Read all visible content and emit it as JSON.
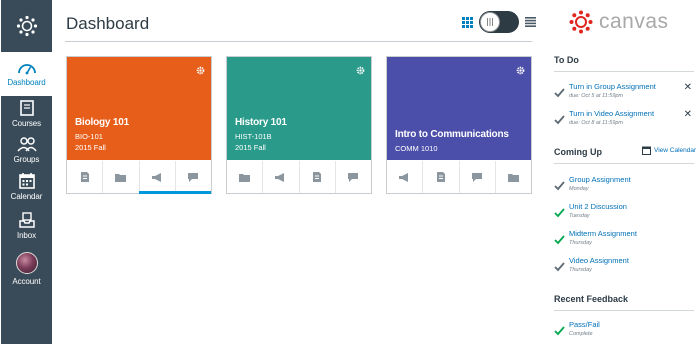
{
  "nav": {
    "items": [
      {
        "label": "Dashboard",
        "icon": "speedometer-icon"
      },
      {
        "label": "Courses",
        "icon": "book-icon"
      },
      {
        "label": "Groups",
        "icon": "people-icon"
      },
      {
        "label": "Calendar",
        "icon": "calendar-icon"
      },
      {
        "label": "Inbox",
        "icon": "inbox-icon"
      },
      {
        "label": "Account",
        "icon": "avatar"
      }
    ]
  },
  "header": {
    "title": "Dashboard"
  },
  "cards": [
    {
      "name": "Biology 101",
      "code": "BIO-101",
      "term": "2015 Fall",
      "color": "#e75e1a",
      "actions": [
        "assignments-icon",
        "files-icon",
        "announcements-icon",
        "discussions-icon"
      ]
    },
    {
      "name": "History 101",
      "code": "HIST-101B",
      "term": "2015 Fall",
      "color": "#2a9a8b",
      "actions": [
        "files-icon",
        "announcements-icon",
        "assignments-icon",
        "discussions-icon"
      ]
    },
    {
      "name": "Intro to Communications",
      "code": "COMM 1010",
      "term": "",
      "color": "#4c4faa",
      "actions": [
        "announcements-icon",
        "assignments-icon",
        "discussions-icon",
        "files-icon"
      ]
    }
  ],
  "sidebar": {
    "logo_text": "canvas",
    "todo": {
      "title": "To Do",
      "items": [
        {
          "title": "Turn in Group Assignment",
          "due": "due: Oct 5 at 11:59pm"
        },
        {
          "title": "Turn in Video Assignment",
          "due": "due: Oct 8 at 11:59pm"
        }
      ]
    },
    "coming_up": {
      "title": "Coming Up",
      "view_calendar": "View Calendar",
      "items": [
        {
          "title": "Group Assignment",
          "day": "Monday",
          "done": false
        },
        {
          "title": "Unit 2 Discussion",
          "day": "Tuesday",
          "done": true
        },
        {
          "title": "Midterm Assignment",
          "day": "Thursday",
          "done": true
        },
        {
          "title": "Video Assignment",
          "day": "Thursday",
          "done": false
        }
      ]
    },
    "feedback": {
      "title": "Recent Feedback",
      "items": [
        {
          "title": "Pass/Fail",
          "status": "Complete",
          "done": true
        }
      ]
    }
  },
  "colors": {
    "nav_bg": "#394b58",
    "link": "#0070b8",
    "active": "#0081bd",
    "brand_red": "#e0261f"
  }
}
